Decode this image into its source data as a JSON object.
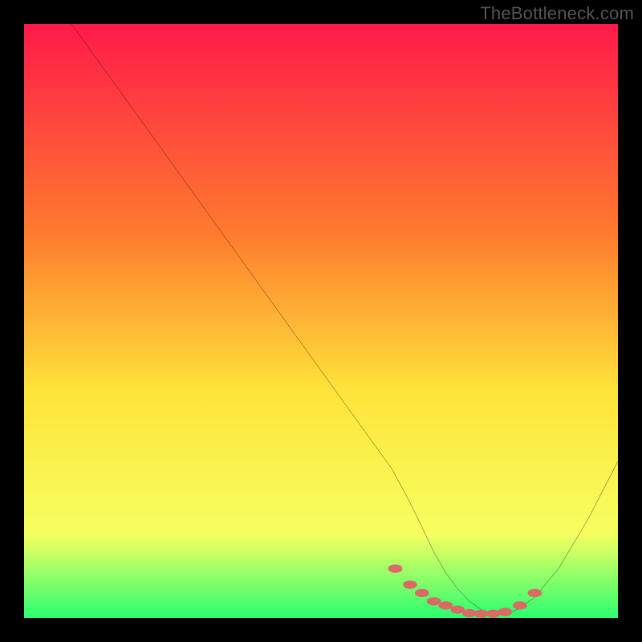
{
  "watermark": "TheBottleneck.com",
  "chart_data": {
    "type": "line",
    "title": "",
    "xlabel": "",
    "ylabel": "",
    "xlim": [
      0,
      100
    ],
    "ylim": [
      0,
      100
    ],
    "gradient": {
      "top": "#ff1a4a",
      "mid_upper": "#ff7a2e",
      "mid": "#ffe43a",
      "mid_lower": "#f5ff60",
      "bottom": "#2aff70"
    },
    "series": [
      {
        "name": "curve",
        "color": "black",
        "x": [
          8,
          15,
          25,
          35,
          45,
          55,
          62,
          65,
          67,
          69,
          71,
          73,
          75,
          77,
          79,
          81,
          83,
          86,
          90,
          95,
          100
        ],
        "y": [
          100,
          90.3,
          76.4,
          62.5,
          48.6,
          34.7,
          25,
          19.4,
          15.3,
          11.1,
          7.6,
          4.9,
          2.8,
          1.4,
          0.6,
          0.6,
          1.4,
          3.5,
          8.3,
          16.7,
          26.4
        ]
      }
    ],
    "markers": {
      "name": "dots",
      "color": "#d96a65",
      "x": [
        62.5,
        65,
        67,
        69,
        71,
        73,
        75,
        77,
        79,
        81,
        83.5,
        86
      ],
      "y": [
        8.3,
        5.6,
        4.2,
        2.8,
        2.1,
        1.4,
        0.8,
        0.7,
        0.7,
        1.0,
        2.1,
        4.2
      ],
      "rx": 1.2,
      "ry": 0.7
    }
  }
}
